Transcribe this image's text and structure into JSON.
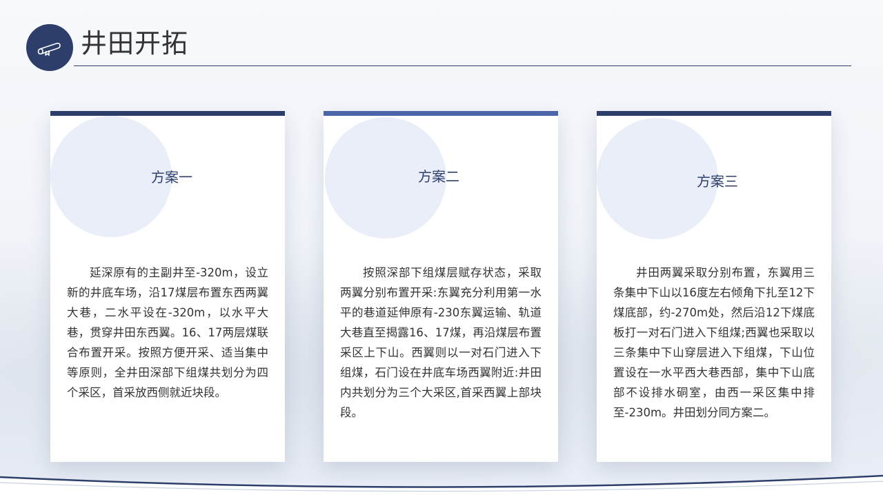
{
  "header": {
    "title": "井田开拓",
    "icon": "diploma-scroll-icon",
    "accent_color": "#2d3e6b"
  },
  "cards": [
    {
      "title": "方案一",
      "bar_color": "#2d3e6b",
      "body": "延深原有的主副井至-320m，设立新的井底车场，沿17煤层布置东西两翼大巷，二水平设在-320m，以水平大巷，贯穿井田东西翼。16、17两层煤联合布置开采。按照方便开采、适当集中等原则，全井田深部下组煤共划分为四个采区，首采放西侧就近块段。"
    },
    {
      "title": "方案二",
      "bar_color": "#4a66a8",
      "body": "按照深部下组煤层赋存状态，采取两翼分别布置开采:东翼充分利用第一水平的巷道延伸原有-230东翼运输、轨道大巷直至揭露16、17煤，再沿煤层布置采区上下山。西翼则以一对石门进入下组煤，石门设在井底车场西翼附近:井田内共划分为三个大采区,首采西翼上部块段。"
    },
    {
      "title": "方案三",
      "bar_color": "#2d3e6b",
      "body": "井田两翼采取分别布置，东翼用三条集中下山以16度左右倾角下扎至12下煤底部，约-270m处，然后沿12下煤底板打一对石门进入下组煤;西翼也采取以三条集中下山穿层进入下组煤，下山位置设在一水平西大巷西部，集中下山底部不设排水硐室，由西一采区集中排至-230m。井田划分同方案二。"
    }
  ]
}
